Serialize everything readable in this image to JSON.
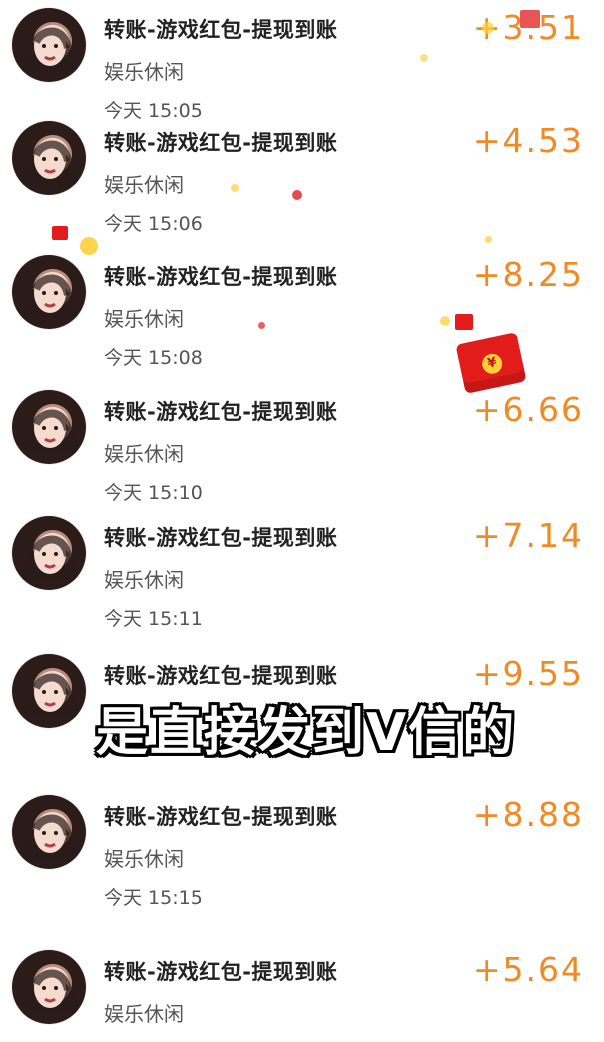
{
  "entries": [
    {
      "title": "转账-游戏红包-提现到账",
      "subtitle": "娱乐休闲",
      "time": "今天 15:05",
      "amount": "+3.51"
    },
    {
      "title": "转账-游戏红包-提现到账",
      "subtitle": "娱乐休闲",
      "time": "今天 15:06",
      "amount": "+4.53"
    },
    {
      "title": "转账-游戏红包-提现到账",
      "subtitle": "娱乐休闲",
      "time": "今天 15:08",
      "amount": "+8.25"
    },
    {
      "title": "转账-游戏红包-提现到账",
      "subtitle": "娱乐休闲",
      "time": "今天 15:10",
      "amount": "+6.66"
    },
    {
      "title": "转账-游戏红包-提现到账",
      "subtitle": "娱乐休闲",
      "time": "今天 15:11",
      "amount": "+7.14"
    },
    {
      "title": "转账-游戏红包-提现到账",
      "subtitle": "",
      "time": "",
      "amount": "+9.55"
    },
    {
      "title": "转账-游戏红包-提现到账",
      "subtitle": "娱乐休闲",
      "time": "今天 15:15",
      "amount": "+8.88"
    },
    {
      "title": "转账-游戏红包-提现到账",
      "subtitle": "娱乐休闲",
      "time": "",
      "amount": "+5.64"
    }
  ],
  "overlay": {
    "caption": "是直接发到V信的"
  },
  "decor": {
    "packet_symbol": "¥"
  },
  "colors": {
    "amount": "#f08a24",
    "title": "#222222",
    "subtitle": "#555555",
    "red_packet": "#e21b1b"
  }
}
